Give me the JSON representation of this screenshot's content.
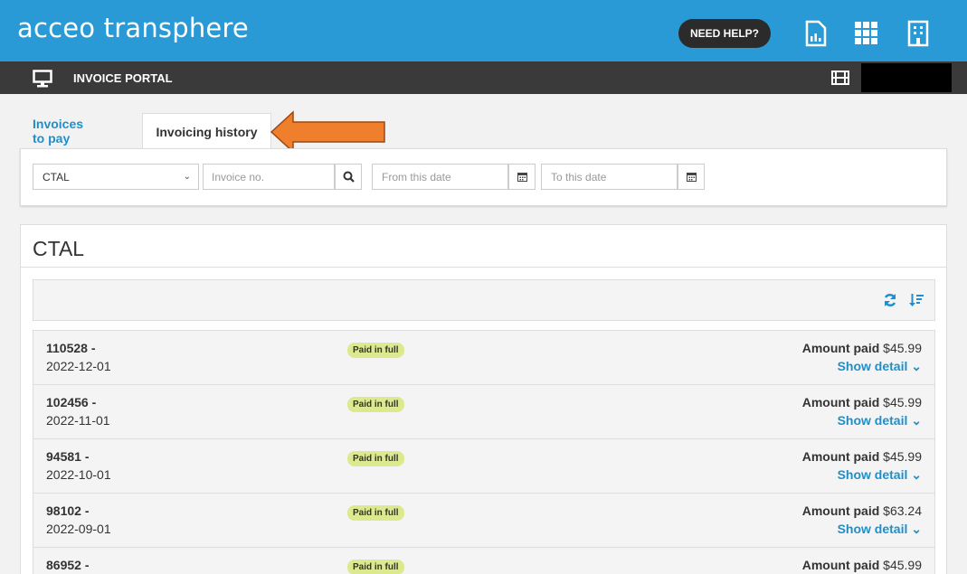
{
  "header": {
    "logo": "acceo transphere",
    "help_label": "NEED HELP?",
    "brand_color": "#2a9ad6",
    "icons": [
      "report-icon",
      "apps-grid-icon",
      "building-icon"
    ]
  },
  "subbar": {
    "portal_label": "INVOICE PORTAL",
    "icons": [
      "monitor-icon",
      "film-icon"
    ]
  },
  "tabs": [
    {
      "label": "Invoices to pay",
      "active": false
    },
    {
      "label": "Invoicing history",
      "active": true
    }
  ],
  "filters": {
    "account_select": "CTAL",
    "invoice_placeholder": "Invoice no.",
    "from_placeholder": "From this date",
    "to_placeholder": "To this date"
  },
  "panel": {
    "title": "CTAL",
    "toolbar_icons": [
      "refresh-icon",
      "sort-icon"
    ]
  },
  "invoices": [
    {
      "number": "110528 -",
      "date": "2022-12-01",
      "status": "Paid in full",
      "amount_label": "Amount paid",
      "amount": "$45.99",
      "detail": "Show detail"
    },
    {
      "number": "102456 -",
      "date": "2022-11-01",
      "status": "Paid in full",
      "amount_label": "Amount paid",
      "amount": "$45.99",
      "detail": "Show detail"
    },
    {
      "number": "94581 -",
      "date": "2022-10-01",
      "status": "Paid in full",
      "amount_label": "Amount paid",
      "amount": "$45.99",
      "detail": "Show detail"
    },
    {
      "number": "98102 -",
      "date": "2022-09-01",
      "status": "Paid in full",
      "amount_label": "Amount paid",
      "amount": "$63.24",
      "detail": "Show detail"
    },
    {
      "number": "86952 -",
      "date": "",
      "status": "Paid in full",
      "amount_label": "Amount paid",
      "amount": "$45.99",
      "detail": ""
    }
  ],
  "colors": {
    "accent": "#2a9ad6",
    "link": "#1e8fcb",
    "status_badge": "#dde98f",
    "annotation_arrow": "#f07f2d"
  }
}
